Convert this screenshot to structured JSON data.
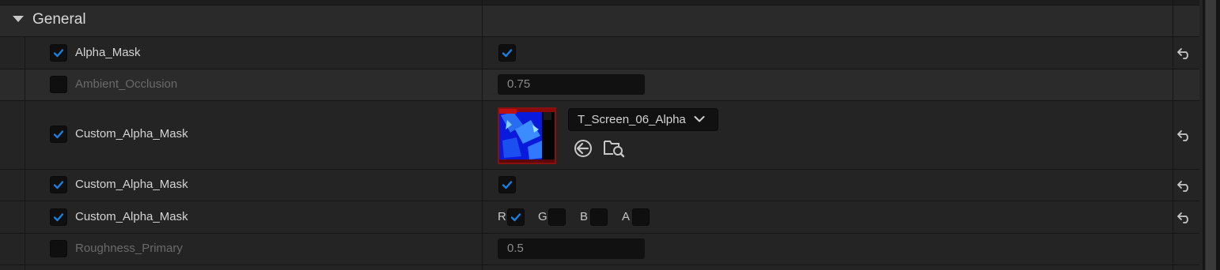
{
  "section": {
    "title": "General"
  },
  "rows": [
    {
      "label": "Alpha_Mask",
      "enabled": true,
      "value_checked": true
    },
    {
      "label": "Ambient_Occlusion",
      "enabled": false,
      "value": "0.75"
    },
    {
      "label": "Custom_Alpha_Mask",
      "enabled": true,
      "asset_name": "T_Screen_06_Alpha"
    },
    {
      "label": "Custom_Alpha_Mask",
      "enabled": true,
      "value_checked": true
    },
    {
      "label": "Custom_Alpha_Mask",
      "enabled": true,
      "channels": [
        {
          "name": "R",
          "checked": true
        },
        {
          "name": "G",
          "checked": false
        },
        {
          "name": "B",
          "checked": false
        },
        {
          "name": "A",
          "checked": false
        }
      ]
    },
    {
      "label": "Roughness_Primary",
      "enabled": false,
      "value": "0.5"
    }
  ],
  "icons": {
    "reset": "reset-to-default-icon",
    "use_selected": "use-selected-asset-icon",
    "browse": "browse-to-asset-icon",
    "expand": "triangle-down-icon",
    "dropdown": "chevron-down-icon",
    "check": "checkmark-icon"
  },
  "colors": {
    "accent": "#1a7fe0",
    "background": "#242424",
    "field": "#111111"
  }
}
